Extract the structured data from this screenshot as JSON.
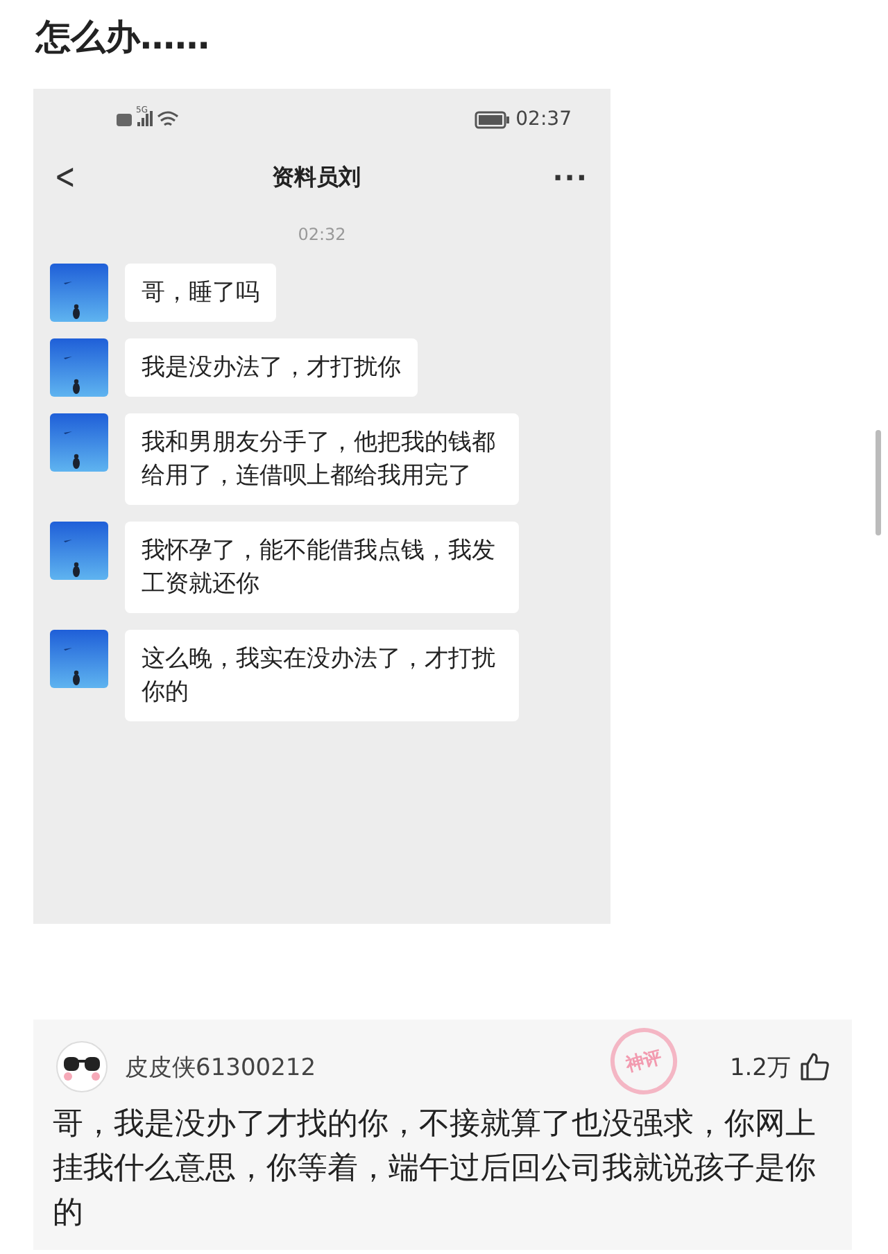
{
  "title": "怎么办……",
  "screenshot": {
    "status_bar": {
      "network": "5G",
      "time": "02:37"
    },
    "header": {
      "back": "<",
      "title": "资料员刘",
      "more": "···"
    },
    "timestamp": "02:32",
    "messages": [
      {
        "text": "哥，睡了吗"
      },
      {
        "text": "我是没办法了，才打扰你"
      },
      {
        "text": "我和男朋友分手了，他把我的钱都给用了，连借呗上都给我用完了"
      },
      {
        "text": "我怀孕了，能不能借我点钱，我发工资就还你"
      },
      {
        "text": "这么晚，我实在没办法了，才打扰你的"
      }
    ]
  },
  "comment": {
    "username": "皮皮侠61300212",
    "badge": "神评",
    "likes": "1.2万",
    "text": "哥，我是没办了才找的你，不接就算了也没强求，你网上挂我什么意思，你等着，端午过后回公司我就说孩子是你的"
  }
}
